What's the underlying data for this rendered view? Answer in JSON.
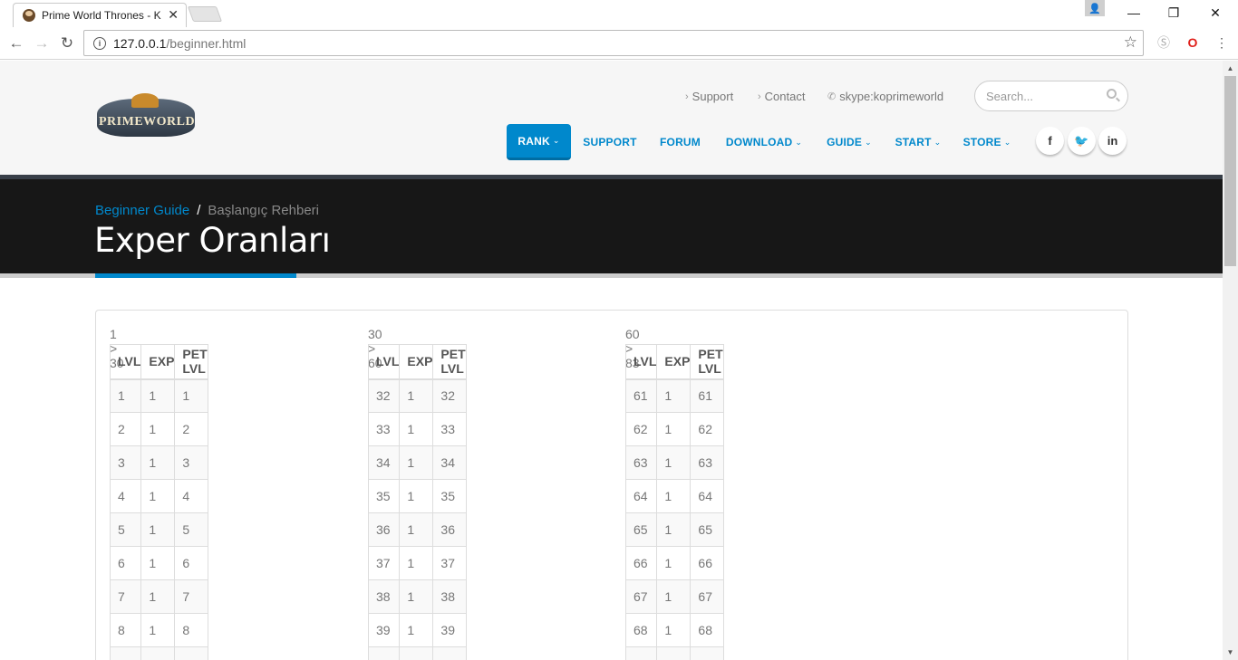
{
  "browser": {
    "tab_title": "Prime World Thrones - K",
    "url_host": "127.0.0.1",
    "url_path": "/beginner.html"
  },
  "site": {
    "logo_text": "PRIMEWORLD",
    "top_links": [
      "Support",
      "Contact",
      "skype:koprimeworld"
    ],
    "search_placeholder": "Search...",
    "menu": [
      "RANK",
      "SUPPORT",
      "FORUM",
      "DOWNLOAD",
      "GUIDE",
      "START",
      "STORE"
    ],
    "accent_color": "#0088cc"
  },
  "title_bar": {
    "breadcrumb_home": "Beginner Guide",
    "breadcrumb_current": "Başlangıç Rehberi",
    "page_title": "Exper Oranları"
  },
  "tables": [
    {
      "caption": "1 > 30",
      "headers": [
        "LVL",
        "EXP",
        "PET LVL"
      ],
      "rows": [
        [
          "1",
          "1",
          "1"
        ],
        [
          "2",
          "1",
          "2"
        ],
        [
          "3",
          "1",
          "3"
        ],
        [
          "4",
          "1",
          "4"
        ],
        [
          "5",
          "1",
          "5"
        ],
        [
          "6",
          "1",
          "6"
        ],
        [
          "7",
          "1",
          "7"
        ],
        [
          "8",
          "1",
          "8"
        ]
      ]
    },
    {
      "caption": "30 > 60",
      "headers": [
        "LVL",
        "EXP",
        "PET LVL"
      ],
      "rows": [
        [
          "32",
          "1",
          "32"
        ],
        [
          "33",
          "1",
          "33"
        ],
        [
          "34",
          "1",
          "34"
        ],
        [
          "35",
          "1",
          "35"
        ],
        [
          "36",
          "1",
          "36"
        ],
        [
          "37",
          "1",
          "37"
        ],
        [
          "38",
          "1",
          "38"
        ],
        [
          "39",
          "1",
          "39"
        ]
      ]
    },
    {
      "caption": "60 > 83",
      "headers": [
        "LVL",
        "EXP",
        "PET LVL"
      ],
      "rows": [
        [
          "61",
          "1",
          "61"
        ],
        [
          "62",
          "1",
          "62"
        ],
        [
          "63",
          "1",
          "63"
        ],
        [
          "64",
          "1",
          "64"
        ],
        [
          "65",
          "1",
          "65"
        ],
        [
          "66",
          "1",
          "66"
        ],
        [
          "67",
          "1",
          "67"
        ],
        [
          "68",
          "1",
          "68"
        ]
      ]
    }
  ]
}
